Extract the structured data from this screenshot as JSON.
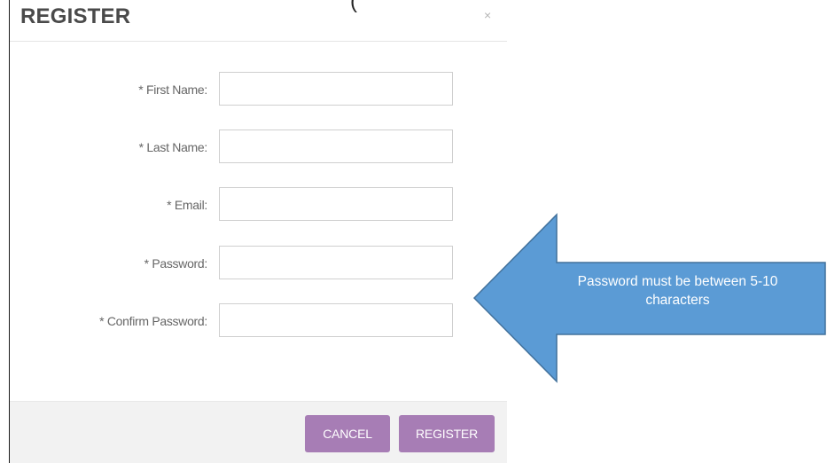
{
  "dialog": {
    "title": "REGISTER",
    "title_fragment": "(",
    "close_symbol": "×"
  },
  "form": {
    "fields": [
      {
        "label": "* First Name:",
        "value": ""
      },
      {
        "label": "* Last Name:",
        "value": ""
      },
      {
        "label": "* Email:",
        "value": ""
      },
      {
        "label": "* Password:",
        "value": ""
      },
      {
        "label": "* Confirm Password:",
        "value": ""
      }
    ]
  },
  "footer": {
    "cancel_label": "CANCEL",
    "register_label": "REGISTER"
  },
  "callout": {
    "text_line1": "Password must be between 5-10",
    "text_line2": "characters",
    "fill_color": "#5b9bd5",
    "stroke_color": "#41719c"
  },
  "colors": {
    "button": "#a77db5",
    "footer_bg": "#f2f2f2",
    "title": "#4a4a4a",
    "label": "#666666"
  }
}
